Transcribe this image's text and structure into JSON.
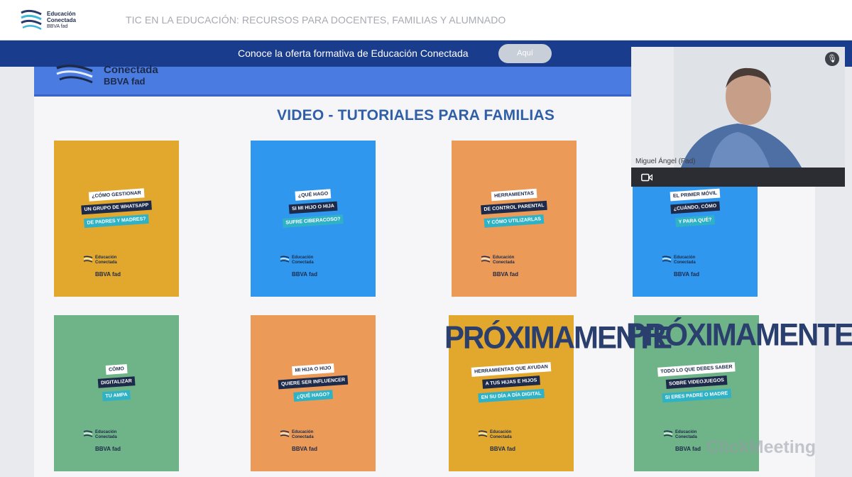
{
  "app": {
    "logo": {
      "line1": "Educación",
      "line2": "Conectada",
      "brands": "BBVA   fad"
    },
    "window_title": "TIC EN LA EDUCACIÓN: RECURSOS PARA DOCENTES, FAMILIAS Y ALUMNADO"
  },
  "banner": {
    "text": "Conoce la oferta formativa de Educación Conectada",
    "button_label": "Aquí"
  },
  "slide": {
    "logo": {
      "line1": "Conectada",
      "brands": "BBVA   fad"
    },
    "title": "VIDEO - TUTORIALES PARA FAMILIAS",
    "cards": [
      {
        "line1": "¿Cómo gestionar",
        "line2": "un grupo de WhatsApp",
        "line3": "de padres y madres?",
        "logo": "Educación Conectada",
        "brands": "BBVA  fad",
        "color": "#e2a82e"
      },
      {
        "line1": "¿Qué hago",
        "line2": "si mi hijo o hija",
        "line3": "sufre ciberacoso?",
        "logo": "Educación Conectada",
        "brands": "BBVA  fad",
        "color": "#2f98ee"
      },
      {
        "line1": "Herramientas",
        "line2": "de control parental",
        "line3": "y cómo utilizarlas",
        "logo": "Educación Conectada",
        "brands": "BBVA  fad",
        "color": "#ec9a57"
      },
      {
        "line1": "El primer móvil",
        "line2": "¿Cuándo, cómo",
        "line3": "y para qué?",
        "logo": "Educación Conectada",
        "brands": "BBVA  fad",
        "color": "#2f98ee"
      },
      {
        "line1": "Cómo",
        "line2": "digitalizar",
        "line3": "tu AMPA",
        "logo": "Educación Conectada",
        "brands": "BBVA  fad",
        "color": "#6fb388"
      },
      {
        "line1": "Mi hija o hijo",
        "line2": "quiere ser influencer",
        "line3": "¿Qué hago?",
        "logo": "Educación Conectada",
        "brands": "BBVA  fad",
        "color": "#ec9a57"
      },
      {
        "line1": "Herramientas que ayudan",
        "line2": "a tus hijas e hijos",
        "line3": "en su día a día digital",
        "logo": "Educación Conectada",
        "brands": "BBVA  fad",
        "color": "#e2a82e",
        "overlay": "PRÓXIMAMENTE"
      },
      {
        "line1": "Todo lo que debes saber",
        "line2": "sobre videojuegos",
        "line3": "si eres padre o madre",
        "logo": "Educación Conectada",
        "brands": "BBVA  fad",
        "color": "#6fb388",
        "overlay": "PRÓXIMAMENTE"
      }
    ]
  },
  "video": {
    "participant_name": "Miguel Ángel (Fad)",
    "mic_icon": "microphone-icon",
    "cam_icon": "camera-icon"
  },
  "watermark": "ClickMeeting"
}
